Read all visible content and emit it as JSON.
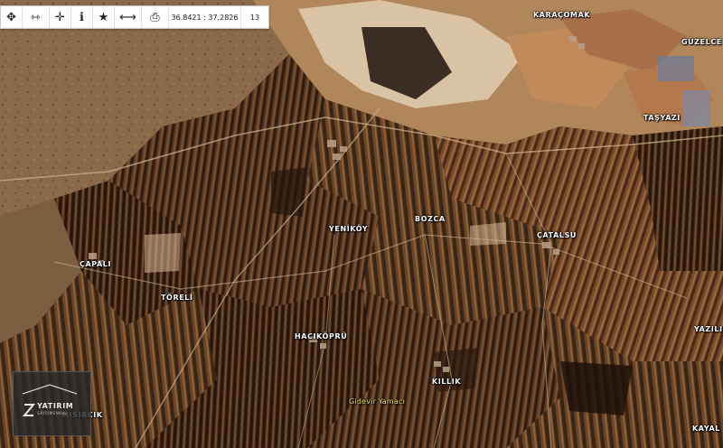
{
  "toolbar": {
    "buttons": [
      {
        "name": "pan-move-icon",
        "glyph": "✥"
      },
      {
        "name": "measure-distance-icon",
        "glyph": "⇿"
      },
      {
        "name": "crosshair-icon",
        "glyph": "✛"
      },
      {
        "name": "info-icon",
        "glyph": "ℹ"
      },
      {
        "name": "favorite-star-icon",
        "glyph": "★"
      },
      {
        "name": "ruler-icon",
        "glyph": "⟷"
      },
      {
        "name": "print-icon",
        "glyph": "⎙"
      }
    ],
    "overlay_id": "412296979",
    "coordinates": "36.8421 : 37.2826",
    "zoom": "13"
  },
  "map": {
    "labels": [
      {
        "name": "label-karacomak",
        "text": "KARAÇOMAK",
        "type": "village"
      },
      {
        "name": "label-guzelce",
        "text": "GÜZELCE",
        "type": "village"
      },
      {
        "name": "label-tasyazi",
        "text": "TAŞYAZI",
        "type": "village"
      },
      {
        "name": "label-yenikoy",
        "text": "YENİKÖY",
        "type": "village"
      },
      {
        "name": "label-bozca",
        "text": "BOZCA",
        "type": "village"
      },
      {
        "name": "label-catalsu",
        "text": "ÇATALSU",
        "type": "village"
      },
      {
        "name": "label-capali",
        "text": "ÇAPALI",
        "type": "village"
      },
      {
        "name": "label-toreli",
        "text": "TÖRELİ",
        "type": "village"
      },
      {
        "name": "label-hacikopru",
        "text": "HACIKÖPRÜ",
        "type": "village"
      },
      {
        "name": "label-killik",
        "text": "KILLIK",
        "type": "village"
      },
      {
        "name": "label-gidevir-yamaci",
        "text": "Gidevir Yamacı",
        "type": "poi"
      },
      {
        "name": "label-mısırcık",
        "text": "MISIRCIK",
        "type": "village"
      },
      {
        "name": "label-yazili",
        "text": "YAZILI",
        "type": "village"
      },
      {
        "name": "label-kayal",
        "text": "KAYAL",
        "type": "village"
      }
    ]
  },
  "watermark": {
    "brand": "YATIRIM",
    "sub": "GAYRİMENKUL"
  }
}
